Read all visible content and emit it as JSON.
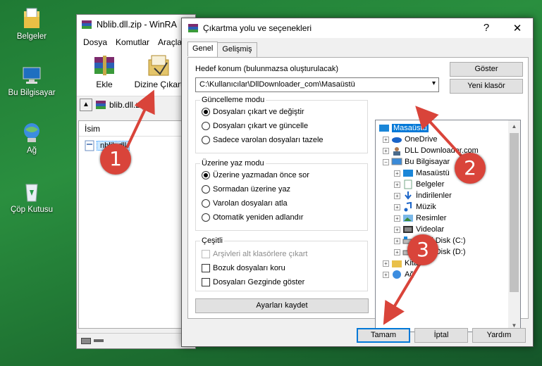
{
  "desktop": {
    "icons": [
      {
        "label": "Belgeler",
        "icon": "folder-documents-icon"
      },
      {
        "label": "Bu Bilgisayar",
        "icon": "computer-icon"
      },
      {
        "label": "Ağ",
        "icon": "network-icon"
      },
      {
        "label": "Çöp Kutusu",
        "icon": "recycle-bin-icon"
      }
    ]
  },
  "winrar": {
    "title": "Nblib.dll.zip - WinRA",
    "menu": [
      "Dosya",
      "Komutlar",
      "Araçla"
    ],
    "toolbar": {
      "add": "Ekle",
      "extract": "Dizine Çıkart"
    },
    "address": "blib.dll.zip",
    "column": "İsim",
    "file": "nblib.dll"
  },
  "dialog": {
    "title": "Çıkartma yolu ve seçenekleri",
    "help": "?",
    "close": "✕",
    "tabs": [
      "Genel",
      "Gelişmiş"
    ],
    "dest_label": "Hedef konum (bulunmazsa oluşturulacak)",
    "dest_value": "C:\\Kullanıcılar\\DllDownloader_com\\Masaüstü",
    "show_button": "Göster",
    "new_folder_button": "Yeni klasör",
    "update_group": {
      "title": "Güncelleme modu",
      "options": [
        "Dosyaları çıkart ve değiştir",
        "Dosyaları çıkart ve güncelle",
        "Sadece varolan dosyaları tazele"
      ],
      "selected": 0
    },
    "overwrite_group": {
      "title": "Üzerine yaz modu",
      "options": [
        "Üzerine yazmadan önce sor",
        "Sormadan üzerine yaz",
        "Varolan dosyaları atla",
        "Otomatik yeniden adlandır"
      ],
      "selected": 0
    },
    "misc_group": {
      "title": "Çeşitli",
      "options": [
        "Arşivleri alt klasörlere çıkart",
        "Bozuk dosyaları koru",
        "Dosyaları Gezginde göster"
      ]
    },
    "save_settings": "Ayarları kaydet",
    "tree": {
      "root": "Masaüstü",
      "nodes": [
        "OneDrive",
        "DLL Downloader.com",
        "Bu Bilgisayar",
        "Masaüstü",
        "Belgeler",
        "İndirilenler",
        "Müzik",
        "Resimler",
        "Videolar",
        "Yerel Disk (C:)",
        "Yerel Disk (D:)",
        "Kitap",
        "Ağ"
      ]
    },
    "buttons": {
      "ok": "Tamam",
      "cancel": "İptal",
      "help": "Yardım"
    }
  },
  "annotations": [
    "1",
    "2",
    "3"
  ],
  "colors": {
    "accent": "#0078d7",
    "badge": "#d9443a"
  }
}
